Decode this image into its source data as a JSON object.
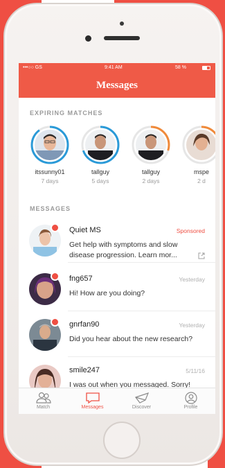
{
  "status_bar": {
    "carrier": "•••○○ GS",
    "time": "9:41 AM",
    "battery": "58 %"
  },
  "nav": {
    "title": "Messages"
  },
  "expiring": {
    "header": "EXPIRING MATCHES",
    "items": [
      {
        "name": "itssunny01",
        "sub": "7 days",
        "ring_color": "#2a9ad8",
        "progress": 0.9
      },
      {
        "name": "tallguy",
        "sub": "5 days",
        "ring_color": "#2a9ad8",
        "progress": 0.7
      },
      {
        "name": "tallguy",
        "sub": "2 days",
        "ring_color": "#f08a3a",
        "progress": 0.3
      },
      {
        "name": "mspe",
        "sub": "2 d",
        "ring_color": "#f08a3a",
        "progress": 0.3
      }
    ]
  },
  "messages": {
    "header": "MESSAGES",
    "items": [
      {
        "name": "Quiet MS",
        "badge": "Sponsored",
        "text": "Get help with symptoms and slow disease progression. Learn mor..."
      },
      {
        "name": "fng657",
        "time": "Yesterday",
        "text": "Hi! How are you doing?"
      },
      {
        "name": "gnrfan90",
        "time": "Yesterday",
        "text": "Did you hear about the new research?"
      },
      {
        "name": "smile247",
        "time": "5/11/16",
        "text": "I was out when you messaged. Sorry!"
      }
    ]
  },
  "tabs": [
    {
      "label": "Match",
      "icon": "people-icon"
    },
    {
      "label": "Messages",
      "icon": "chat-icon"
    },
    {
      "label": "Discover",
      "icon": "discover-icon"
    },
    {
      "label": "Profile",
      "icon": "profile-icon"
    }
  ],
  "colors": {
    "accent": "#ef5a47",
    "ring_blue": "#2a9ad8",
    "ring_orange": "#f08a3a"
  }
}
